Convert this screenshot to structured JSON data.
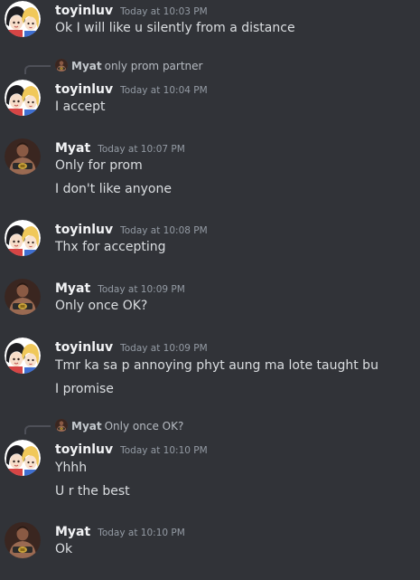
{
  "colors": {
    "background": "#313338",
    "username": "#f2f3f5",
    "message_text": "#dbdee1",
    "timestamp": "#949ba4"
  },
  "messages": [
    {
      "author": "toyinluv",
      "avatar": "anime-couple-avatar",
      "timestamp": "Today at 10:03 PM",
      "lines": [
        "Ok I will like u silently from a distance"
      ]
    },
    {
      "author": "toyinluv",
      "avatar": "anime-couple-avatar",
      "timestamp": "Today at 10:04 PM",
      "reply": {
        "author": "Myat",
        "text": "only prom partner"
      },
      "lines": [
        "I accept"
      ]
    },
    {
      "author": "Myat",
      "avatar": "wrestler-avatar",
      "timestamp": "Today at 10:07 PM",
      "lines": [
        "Only for prom",
        "I don't like anyone"
      ]
    },
    {
      "author": "toyinluv",
      "avatar": "anime-couple-avatar",
      "timestamp": "Today at 10:08 PM",
      "lines": [
        "Thx for accepting"
      ]
    },
    {
      "author": "Myat",
      "avatar": "wrestler-avatar",
      "timestamp": "Today at 10:09 PM",
      "lines": [
        "Only once OK?"
      ]
    },
    {
      "author": "toyinluv",
      "avatar": "anime-couple-avatar",
      "timestamp": "Today at 10:09 PM",
      "lines": [
        "Tmr ka sa p annoying phyt aung ma lote taught bu",
        "I promise"
      ]
    },
    {
      "author": "toyinluv",
      "avatar": "anime-couple-avatar",
      "timestamp": "Today at 10:10 PM",
      "reply": {
        "author": "Myat",
        "text": "Only once OK?"
      },
      "lines": [
        "Yhhh",
        "U r the best"
      ]
    },
    {
      "author": "Myat",
      "avatar": "wrestler-avatar",
      "timestamp": "Today at 10:10 PM",
      "lines": [
        "Ok"
      ]
    }
  ]
}
